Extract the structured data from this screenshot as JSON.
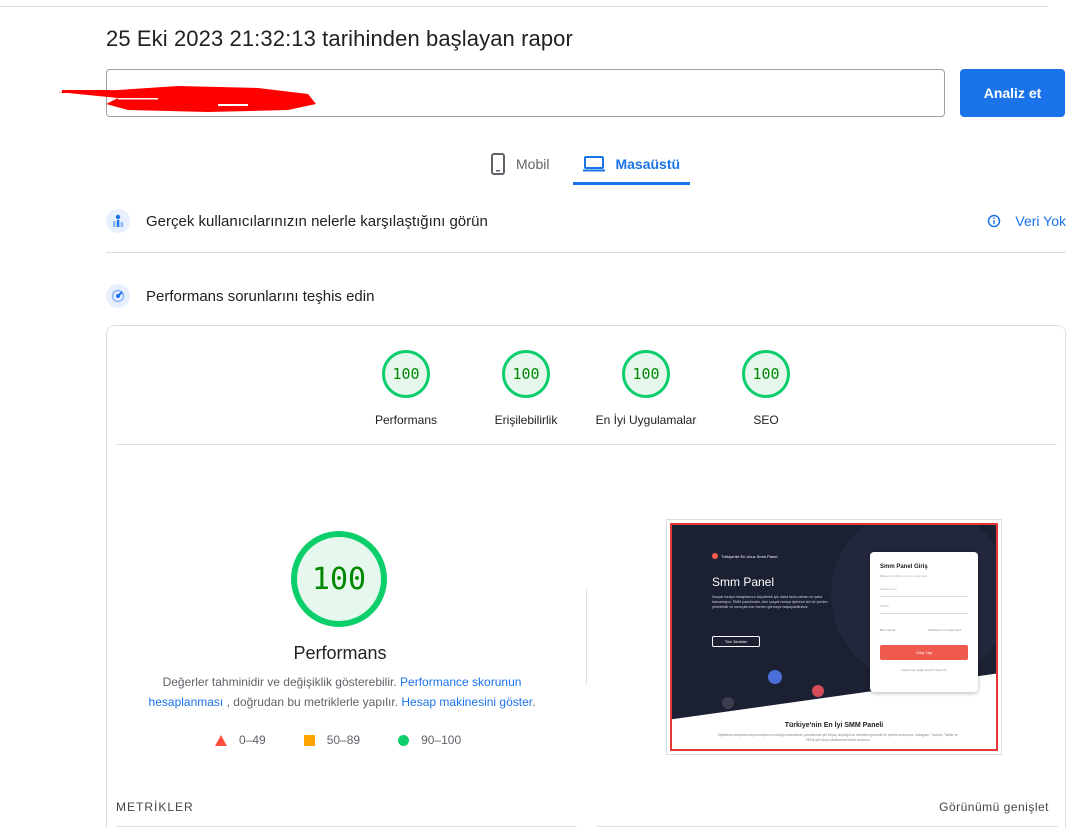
{
  "header": {
    "report_title": "25 Eki 2023 21:32:13 tarihinden başlayan rapor",
    "url_value": "",
    "analyze_label": "Analiz et"
  },
  "tabs": [
    {
      "label": "Mobil",
      "icon": "phone-icon",
      "active": false
    },
    {
      "label": "Masaüstü",
      "icon": "laptop-icon",
      "active": true
    }
  ],
  "field_data": {
    "title": "Gerçek kullanıcılarınızın nelerle karşılaştığını görün",
    "status": "Veri Yok"
  },
  "lab_data": {
    "title": "Performans sorunlarını teşhis edin"
  },
  "categories": [
    {
      "score": "100",
      "label": "Performans"
    },
    {
      "score": "100",
      "label": "Erişilebilirlik"
    },
    {
      "score": "100",
      "label": "En İyi Uygulamalar"
    },
    {
      "score": "100",
      "label": "SEO"
    }
  ],
  "performance": {
    "score": "100",
    "label": "Performans",
    "note_1": "Değerler tahminidir ve değişiklik gösterebilir.",
    "note_link_1": "Performance skorunun hesaplanması",
    "note_2": ", doğrudan bu metriklerle yapılır.",
    "note_link_2": "Hesap makinesini göster",
    "note_3": "."
  },
  "legend": [
    {
      "range": "0–49",
      "color": "#ff4e42"
    },
    {
      "range": "50–89",
      "color": "#ffa400"
    },
    {
      "range": "90–100",
      "color": "#0cce6b"
    }
  ],
  "screenshot": {
    "badge": "Türkiye'de En Ucuz Smm Panel",
    "hero_title": "Smm Panel",
    "hero_text": "Sosyal medya hesaplarınızı büyütmek için daha fazla zaman ve çaba harcamayın. SMM panelimizle, tüm sosyal medya işlerinizi tek bir yerden yönetebilir ve sonuçlarınızı hemen görmeye başlayabilirsiniz.",
    "hero_button": "Tüm Servisler",
    "panel_title": "Smm Panel Giriş",
    "panel_sub": "Bilgilerinizi doğru girin ve erişiminizi",
    "field_user": "Kullanıcı Adı",
    "field_pass": "Parola",
    "remember": "Beni hatırla",
    "forgot": "Parolanızı mı unuttunuz?",
    "login_button": "Giriş Yap",
    "register": "Henüz üye değil misiniz? Kayıt Ol",
    "footer_title": "Türkiye'nin En İyi SMM Paneli",
    "footer_text": "Dijitalleşen dünyada sosyal medyanın sunduğu imkanlardan yararlanmak için ihtiyaç duyduğunuz hizmetleri güvenilir bir şekilde sunuyoruz. Instagram, Youtube, Twitter ve TikTok gibi birçok platformda hizmet veriyoruz."
  },
  "metrics": {
    "title": "METRİKLER",
    "expand": "Görünümü genişlet"
  },
  "colors": {
    "accent": "#1a73e8",
    "pass": "#0cce6b",
    "pass_text": "#008800"
  }
}
